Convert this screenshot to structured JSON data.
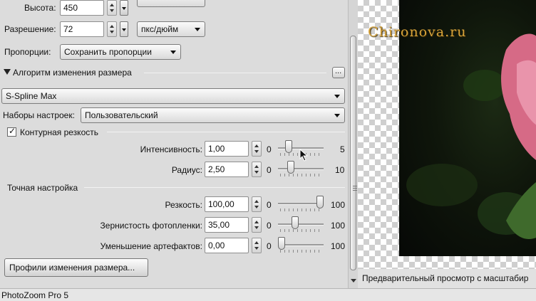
{
  "size": {
    "height_label": "Высота:",
    "height_value": "450",
    "resolution_label": "Разрешение:",
    "resolution_value": "72",
    "resolution_unit": "пкс/дюйм",
    "proportions_label": "Пропорции:",
    "proportions_value": "Сохранить пропорции"
  },
  "resize_algorithm": {
    "section_label": "Алгоритм изменения размера",
    "more_button": "...",
    "method": "S-Spline Max",
    "presets_label": "Наборы настроек:",
    "presets_value": "Пользовательский",
    "sharpness_checkbox_label": "Контурная резкость",
    "sharpness_checked": true
  },
  "contour_sliders": [
    {
      "label": "Интенсивность:",
      "value": "1,00",
      "min": "0",
      "max": "5",
      "position": 0.12
    },
    {
      "label": "Радиус:",
      "value": "2,50",
      "min": "0",
      "max": "10",
      "position": 0.25
    }
  ],
  "fine_tuning": {
    "section_label": "Точная настройка",
    "sliders": [
      {
        "label": "Резкость:",
        "value": "100,00",
        "min": "0",
        "max": "100",
        "position": 1.0
      },
      {
        "label": "Зернистость фотопленки:",
        "value": "35,00",
        "min": "0",
        "max": "100",
        "position": 0.35
      },
      {
        "label": "Уменьшение артефактов:",
        "value": "0,00",
        "min": "0",
        "max": "100",
        "position": 0.0
      }
    ]
  },
  "profiles_button": "Профили изменения размера...",
  "preview": {
    "watermark": "Chironova.ru",
    "caption": "Предварительный просмотр с масштабир"
  },
  "status": {
    "app_name": "PhotoZoom Pro 5"
  },
  "icons": [
    "spin-up-icon",
    "spin-down-icon",
    "chevron-down-icon",
    "triangle-expanded-icon",
    "check-icon",
    "scroll-up-icon",
    "scroll-down-icon",
    "mouse-cursor-icon"
  ],
  "colors": {
    "watermark": "#d6a23a",
    "panel": "#dcdcdc"
  }
}
